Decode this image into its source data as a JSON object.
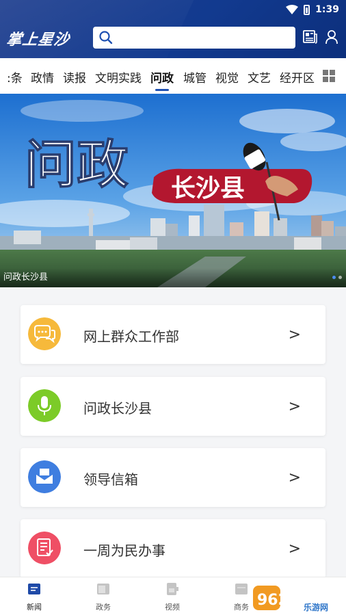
{
  "status": {
    "time": "1:39"
  },
  "header": {
    "logo_text": "掌上星沙",
    "search_placeholder": ""
  },
  "tabs": [
    {
      "label": ":条"
    },
    {
      "label": "政情"
    },
    {
      "label": "读报"
    },
    {
      "label": "文明实践"
    },
    {
      "label": "问政",
      "active": true
    },
    {
      "label": "城管"
    },
    {
      "label": "视觉"
    },
    {
      "label": "文艺"
    },
    {
      "label": "经开区"
    }
  ],
  "banner": {
    "title_main": "问政",
    "title_sub": "长沙县",
    "caption": "问政长沙县"
  },
  "cards": [
    {
      "label": "网上群众工作部",
      "arrow": ">",
      "icon": "chat-bubbles-icon",
      "color": "#f6b93b"
    },
    {
      "label": "问政长沙县",
      "arrow": ">",
      "icon": "microphone-icon",
      "color": "#7ccb28"
    },
    {
      "label": "领导信箱",
      "arrow": ">",
      "icon": "mailbox-icon",
      "color": "#3f7ee0"
    },
    {
      "label": "一周为民办事",
      "arrow": ">",
      "icon": "document-check-icon",
      "color": "#ef4f65"
    }
  ],
  "bottom_nav": [
    {
      "label": "新闻",
      "active": true
    },
    {
      "label": "政务"
    },
    {
      "label": "视频"
    },
    {
      "label": "商务"
    }
  ],
  "watermark": {
    "text": "962.NET",
    "sub": "乐游网"
  }
}
